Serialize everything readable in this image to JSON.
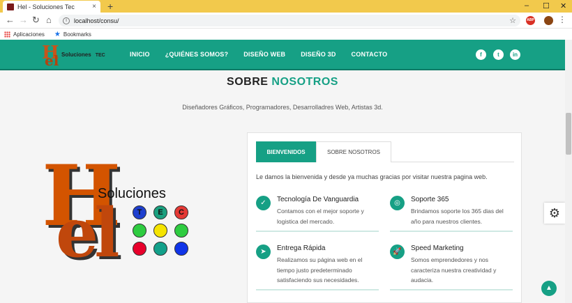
{
  "browser": {
    "tab_title": "Hel - Soluciones Tec",
    "tab_close": "×",
    "new_tab": "+",
    "url": "localhost/consu/",
    "win_min": "–",
    "win_max": "☐",
    "win_close": "✕",
    "ext_abp": "ABP"
  },
  "bookmarks": {
    "apps": "Aplicaciones",
    "bookmarks": "Bookmarks"
  },
  "site": {
    "logo_text": "Soluciones",
    "logo_tec": "TEC",
    "menu": [
      "INICIO",
      "¿QUIÉNES SOMOS?",
      "DISEÑO WEB",
      "DISEÑO 3D",
      "CONTACTO"
    ],
    "social": [
      "f",
      "t",
      "in"
    ]
  },
  "section": {
    "title_a": "SOBRE",
    "title_b": "NOSOTROS",
    "subtitle": "Diseñadores Gráficos, Programadores, Desarrolladres Web, Artistas 3d."
  },
  "biglogo": {
    "H": "H",
    "el": "el",
    "soluciones": "Soluciones",
    "letters": [
      "T",
      "E",
      "C"
    ]
  },
  "card": {
    "tab_active": "BIENVENIDOS",
    "tab_inactive": "SOBRE NOSOTROS",
    "welcome": "Le damos la bienvenida y desde ya muchas gracias por visitar nuestra pagina web.",
    "features": [
      {
        "title": "Tecnología De Vanguardia",
        "desc": "Contamos con el mejor soporte y logistica del mercado.",
        "icon": "✓"
      },
      {
        "title": "Soporte 365",
        "desc": "Brindamos soporte los 365 dias del año para nuestros clientes.",
        "icon": "◎"
      },
      {
        "title": "Entrega Rápida",
        "desc": "Realizamos su página web en el tiempo justo predeterminado satisfaciendo sus necesidades.",
        "icon": "➤"
      },
      {
        "title": "Speed Marketing",
        "desc": "Somos emprendedores y nos caracteriza nuestra creatividad y audacia.",
        "icon": "🚀"
      }
    ]
  },
  "colors": {
    "accent": "#16a085",
    "logo_orange": "#d35400",
    "tab_bar": "#f2c94c"
  }
}
